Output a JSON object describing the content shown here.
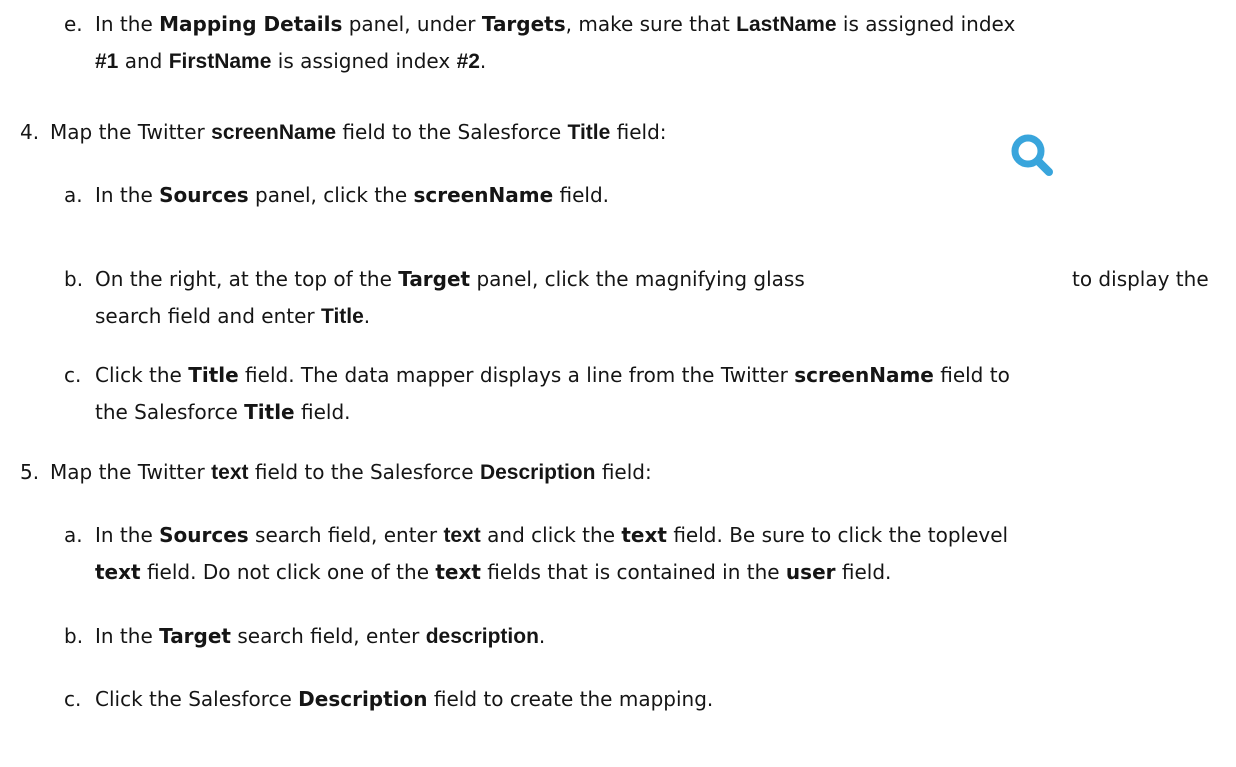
{
  "step_e": {
    "marker": "e.",
    "l1": [
      "In the ",
      "Mapping Details",
      " panel, under ",
      "Targets",
      ", make sure that ",
      "LastName",
      " is assigned index"
    ],
    "l2": [
      "#1",
      " and ",
      "FirstName",
      " is assigned index ",
      "#2",
      "."
    ]
  },
  "step_4": {
    "marker": "4.",
    "l1": [
      "Map the Twitter ",
      "screenName",
      " field to the Salesforce ",
      "Title",
      " field:"
    ]
  },
  "step_4a": {
    "marker": "a.",
    "l1": [
      "In the ",
      "Sources",
      " panel, click the ",
      "screenName",
      " field."
    ]
  },
  "step_4b": {
    "marker": "b.",
    "l1": [
      "On the right, at the top of the ",
      "Target",
      " panel, click the magnifying glass",
      "to display the"
    ],
    "l2": [
      "search field and enter ",
      "Title",
      "."
    ],
    "icon": "magnifying-glass-icon",
    "icon_color": "#39a5dc"
  },
  "step_4c": {
    "marker": "c.",
    "l1": [
      "Click the ",
      "Title",
      " field. The data mapper displays a line from the Twitter ",
      "screenName",
      " field to"
    ],
    "l2": [
      "the Salesforce ",
      "Title",
      " field."
    ]
  },
  "step_5": {
    "marker": "5.",
    "l1": [
      "Map the Twitter ",
      "text",
      " field to the Salesforce ",
      "Description",
      " field:"
    ]
  },
  "step_5a": {
    "marker": "a.",
    "l1": [
      "In the ",
      "Sources",
      " search field, enter ",
      "text",
      " and click the ",
      "text",
      " field. Be sure to click the toplevel"
    ],
    "l2": [
      "text",
      " field. Do not click one of the ",
      "text",
      " fields that is contained in the ",
      "user",
      " field."
    ]
  },
  "step_5b": {
    "marker": "b.",
    "l1": [
      "In the ",
      "Target",
      " search field, enter ",
      "description",
      "."
    ]
  },
  "step_5c": {
    "marker": "c.",
    "l1": [
      "Click the Salesforce ",
      "Description",
      " field to create the mapping."
    ]
  }
}
